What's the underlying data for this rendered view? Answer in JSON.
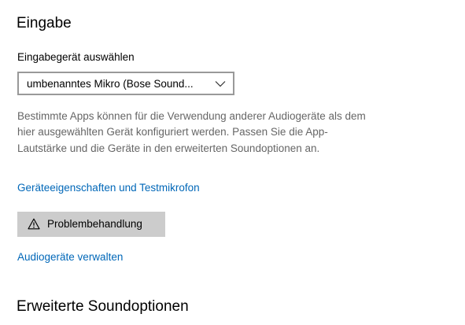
{
  "input_section": {
    "title": "Eingabe",
    "device_label": "Eingabegerät auswählen",
    "device_dropdown": {
      "selected_value": "umbenanntes Mikro (Bose Sound..."
    },
    "description": "Bestimmte Apps können für die Verwendung anderer Audiogeräte als dem hier ausgewählten Gerät konfiguriert werden. Passen Sie die App-Lautstärke und die Geräte in den erweiterten Soundoptionen an.",
    "properties_link": "Geräteeigenschaften und Testmikrofon",
    "troubleshoot_button": {
      "label": "Problembehandlung",
      "icon": "warning-icon"
    },
    "manage_devices_link": "Audiogeräte verwalten"
  },
  "advanced_section": {
    "title": "Erweiterte Soundoptionen"
  },
  "colors": {
    "link": "#0067b8",
    "description_text": "#666666",
    "button_background": "#cccccc",
    "dropdown_border": "#999999"
  }
}
